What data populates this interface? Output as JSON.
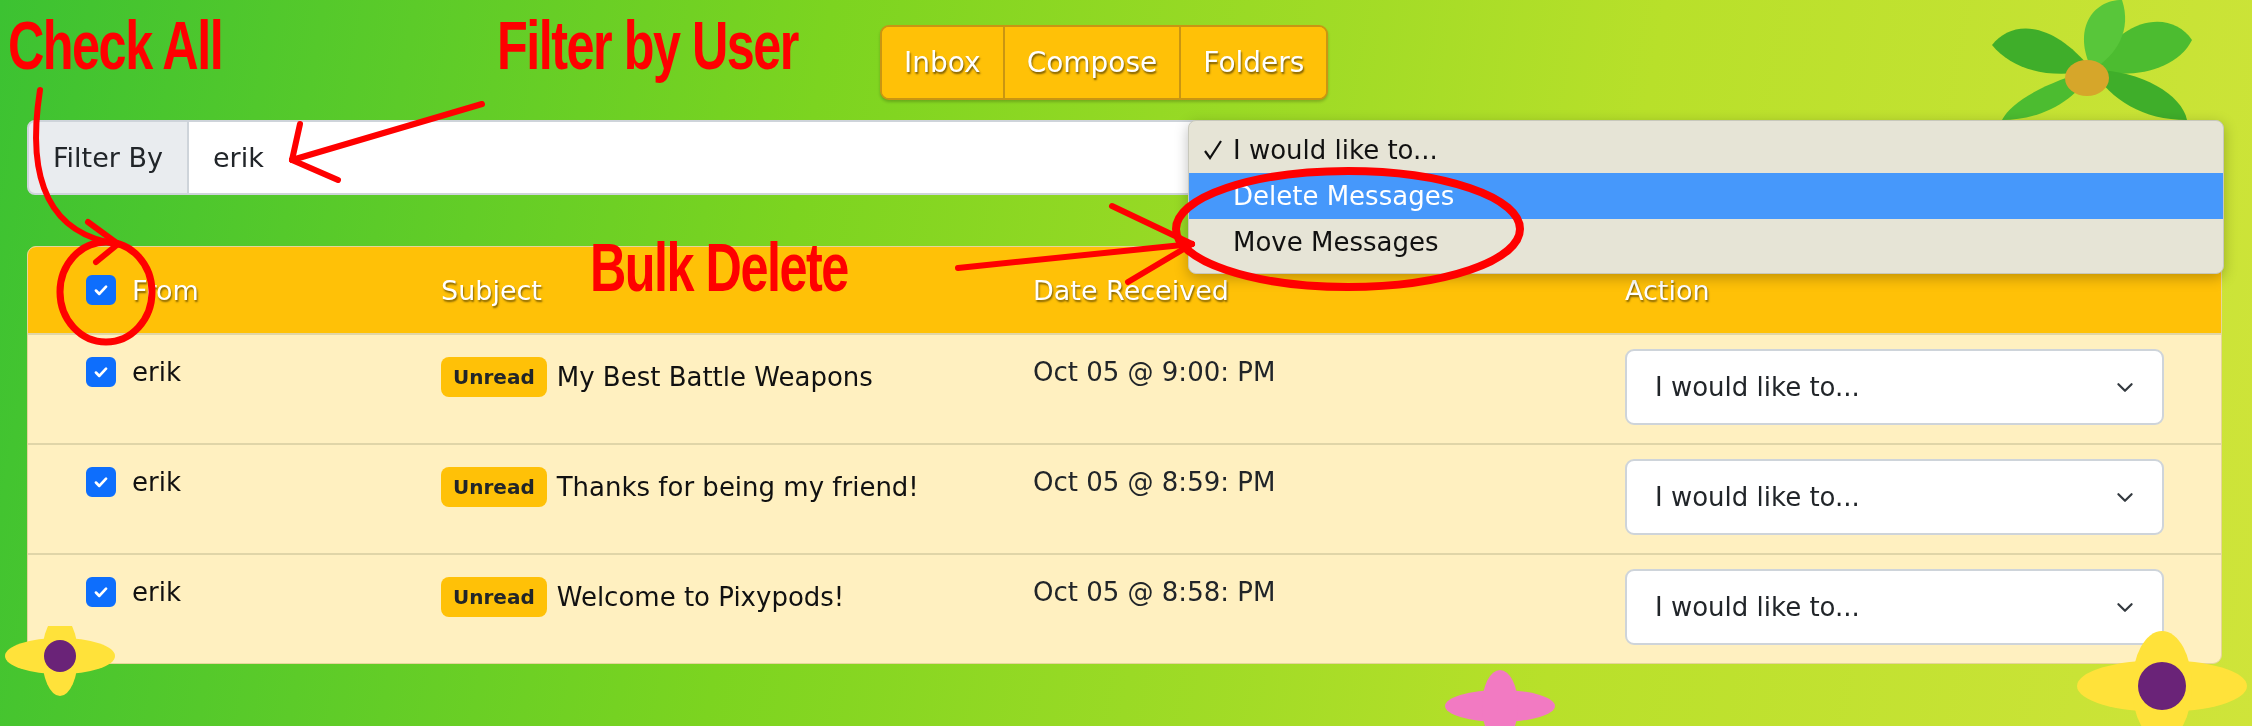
{
  "nav_tabs": [
    {
      "label": "Inbox"
    },
    {
      "label": "Compose"
    },
    {
      "label": "Folders"
    }
  ],
  "filter": {
    "label": "Filter By",
    "value": "erik"
  },
  "action_menu": {
    "items": [
      {
        "label": "I would like to...",
        "checked": true,
        "selected": false
      },
      {
        "label": "Delete Messages",
        "checked": false,
        "selected": true
      },
      {
        "label": "Move Messages",
        "checked": false,
        "selected": false
      }
    ]
  },
  "table": {
    "select_all_checked": true,
    "columns": [
      "From",
      "Subject",
      "Date Received",
      "Action"
    ],
    "rows": [
      {
        "checked": true,
        "from": "erik",
        "badge": "Unread",
        "subject": "My Best Battle Weapons",
        "date": "Oct 05 @ 9:00: PM",
        "action": "I would like to..."
      },
      {
        "checked": true,
        "from": "erik",
        "badge": "Unread",
        "subject": "Thanks for being my friend!",
        "date": "Oct 05 @ 8:59: PM",
        "action": "I would like to..."
      },
      {
        "checked": true,
        "from": "erik",
        "badge": "Unread",
        "subject": "Welcome to Pixypods!",
        "date": "Oct 05 @ 8:58: PM",
        "action": "I would like to..."
      }
    ]
  },
  "annotations": [
    {
      "text": "Check All"
    },
    {
      "text": "Filter by User"
    },
    {
      "text": "Bulk Delete"
    }
  ]
}
